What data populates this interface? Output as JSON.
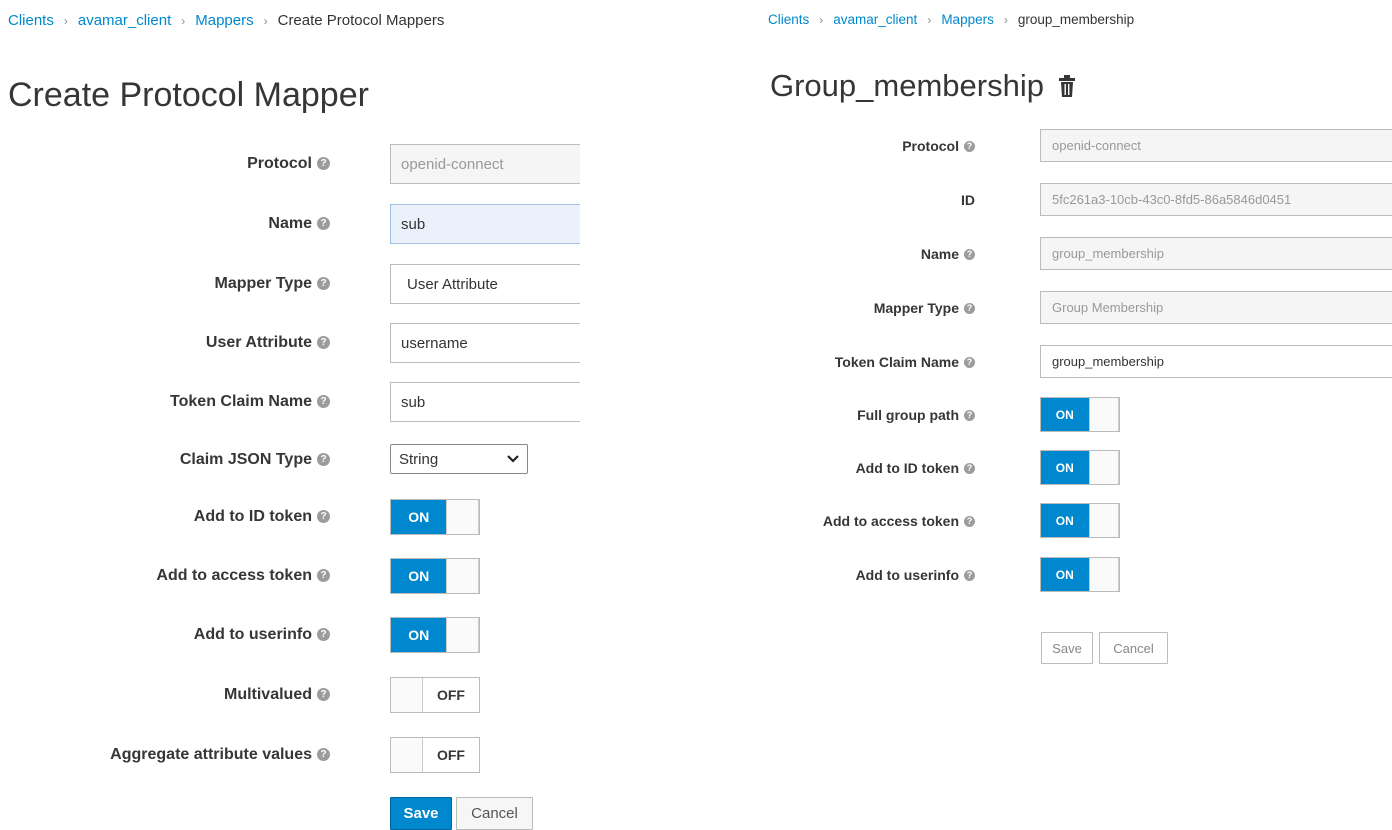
{
  "left": {
    "breadcrumb": [
      "Clients",
      "avamar_client",
      "Mappers",
      "Create Protocol Mappers"
    ],
    "title": "Create Protocol Mapper",
    "fields": {
      "protocol": {
        "label": "Protocol",
        "value": "openid-connect"
      },
      "name": {
        "label": "Name",
        "value": "sub"
      },
      "mapper_type": {
        "label": "Mapper Type",
        "value": "User Attribute"
      },
      "user_attribute": {
        "label": "User Attribute",
        "value": "username"
      },
      "token_claim_name": {
        "label": "Token Claim Name",
        "value": "sub"
      },
      "claim_json_type": {
        "label": "Claim JSON Type",
        "value": "String"
      }
    },
    "toggles": {
      "add_to_id_token": {
        "label": "Add to ID token",
        "state": "ON"
      },
      "add_to_access_token": {
        "label": "Add to access token",
        "state": "ON"
      },
      "add_to_userinfo": {
        "label": "Add to userinfo",
        "state": "ON"
      },
      "multivalued": {
        "label": "Multivalued",
        "state": "OFF"
      },
      "aggregate_attribute_values": {
        "label": "Aggregate attribute values",
        "state": "OFF"
      }
    },
    "buttons": {
      "save": "Save",
      "cancel": "Cancel"
    }
  },
  "right": {
    "breadcrumb": [
      "Clients",
      "avamar_client",
      "Mappers",
      "group_membership"
    ],
    "title": "Group_membership",
    "fields": {
      "protocol": {
        "label": "Protocol",
        "value": "openid-connect"
      },
      "id": {
        "label": "ID",
        "value": "5fc261a3-10cb-43c0-8fd5-86a5846d0451"
      },
      "name": {
        "label": "Name",
        "value": "group_membership"
      },
      "mapper_type": {
        "label": "Mapper Type",
        "value": "Group Membership"
      },
      "token_claim_name": {
        "label": "Token Claim Name",
        "value": "group_membership"
      }
    },
    "toggles": {
      "full_group_path": {
        "label": "Full group path",
        "state": "ON"
      },
      "add_to_id_token": {
        "label": "Add to ID token",
        "state": "ON"
      },
      "add_to_access_token": {
        "label": "Add to access token",
        "state": "ON"
      },
      "add_to_userinfo": {
        "label": "Add to userinfo",
        "state": "ON"
      }
    },
    "buttons": {
      "save": "Save",
      "cancel": "Cancel"
    }
  },
  "icons": {
    "help": "question-circle-icon",
    "delete": "trash-icon",
    "dropdown": "chevron-down-icon",
    "separator": "chevron-right-icon"
  },
  "colors": {
    "primary": "#0088ce",
    "link": "#0088ce",
    "readonly_bg": "#f5f5f5",
    "focused_bg": "#eaf1fc"
  }
}
